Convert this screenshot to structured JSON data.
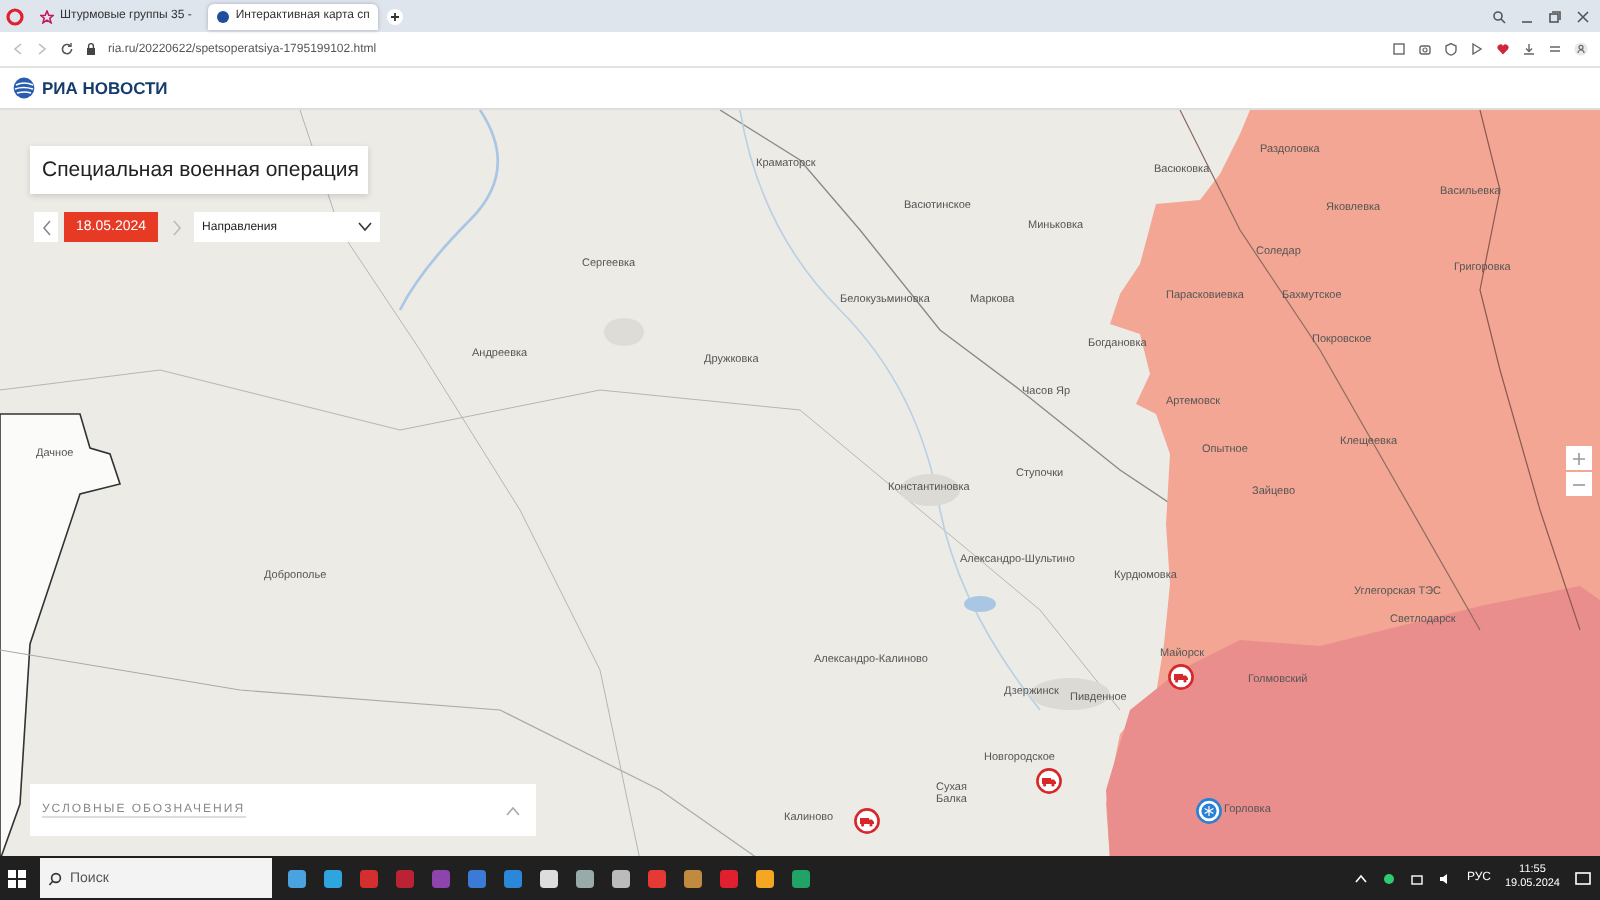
{
  "browser": {
    "tabs": [
      {
        "title": "Штурмовые группы 35 -",
        "selected": false
      },
      {
        "title": "Интерактивная карта сп",
        "selected": true
      }
    ],
    "url": "ria.ru/20220622/spetsoperatsiya-1795199102.html"
  },
  "site": {
    "logo": "РИА НОВОСТИ"
  },
  "map": {
    "title": "Специальная военная операция",
    "date": "18.05.2024",
    "direction": "Направления",
    "legend_title": "УСЛОВНЫЕ ОБОЗНАЧЕНИЯ",
    "places": [
      {
        "name": "Краматорск"
      },
      {
        "name": "Сергеевка"
      },
      {
        "name": "Андреевка"
      },
      {
        "name": "Дружковка"
      },
      {
        "name": "Васютинское"
      },
      {
        "name": "Миньковка"
      },
      {
        "name": "Васюковка"
      },
      {
        "name": "Раздоловка"
      },
      {
        "name": "Яковлевка"
      },
      {
        "name": "Васильевка"
      },
      {
        "name": "Соледар"
      },
      {
        "name": "Григоровка"
      },
      {
        "name": "Белокузьминовка"
      },
      {
        "name": "Маркова"
      },
      {
        "name": "Парасковиевка"
      },
      {
        "name": "Бахмутское"
      },
      {
        "name": "Покровское"
      },
      {
        "name": "Богдановка"
      },
      {
        "name": "Часов Яр"
      },
      {
        "name": "Артемовск"
      },
      {
        "name": "Опытное"
      },
      {
        "name": "Клещеевка"
      },
      {
        "name": "Ступочки"
      },
      {
        "name": "Константиновка"
      },
      {
        "name": "Зайцево"
      },
      {
        "name": "Доброполье"
      },
      {
        "name": "Александро-Шультино"
      },
      {
        "name": "Курдюмовка"
      },
      {
        "name": "Углегорская ТЭС"
      },
      {
        "name": "Светлодарск"
      },
      {
        "name": "Александро-Калиново"
      },
      {
        "name": "Майорск"
      },
      {
        "name": "Дзержинск"
      },
      {
        "name": "Пивденное"
      },
      {
        "name": "Голмовский"
      },
      {
        "name": "Новгородское"
      },
      {
        "name": "Сухая Балка"
      },
      {
        "name": "Калиново"
      },
      {
        "name": "Горловка"
      },
      {
        "name": "Дачное"
      }
    ]
  },
  "taskbar": {
    "search_placeholder": "Поиск",
    "language": "РУС",
    "time": "11:55",
    "date": "19.05.2024"
  }
}
